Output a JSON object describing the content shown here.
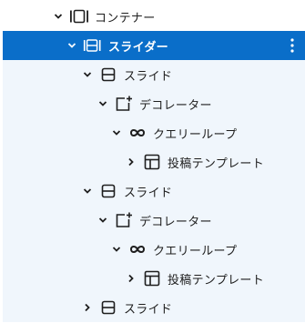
{
  "colors": {
    "selected_bg": "#0a6ec9",
    "selected_text": "#ffffff",
    "tinted_bg": "#f0f6fc",
    "text": "#1e1e1e"
  },
  "tree": {
    "container": {
      "label": "コンテナー",
      "icon": "container-icon",
      "expanded": true
    },
    "slider": {
      "label": "スライダー",
      "icon": "slider-icon",
      "expanded": true,
      "selected": true,
      "menu_icon": "more-vertical-icon"
    },
    "slide_1": {
      "label": "スライド",
      "icon": "slide-icon",
      "expanded": true
    },
    "decorator_1": {
      "label": "デコレーター",
      "icon": "decorator-icon",
      "expanded": true
    },
    "query_loop_1": {
      "label": "クエリーループ",
      "icon": "loop-icon",
      "expanded": true
    },
    "post_template_1": {
      "label": "投稿テンプレート",
      "icon": "template-icon",
      "expanded": false
    },
    "slide_2": {
      "label": "スライド",
      "icon": "slide-icon",
      "expanded": true
    },
    "decorator_2": {
      "label": "デコレーター",
      "icon": "decorator-icon",
      "expanded": true
    },
    "query_loop_2": {
      "label": "クエリーループ",
      "icon": "loop-icon",
      "expanded": true
    },
    "post_template_2": {
      "label": "投稿テンプレート",
      "icon": "template-icon",
      "expanded": false
    },
    "slide_3": {
      "label": "スライド",
      "icon": "slide-icon",
      "expanded": false
    }
  }
}
